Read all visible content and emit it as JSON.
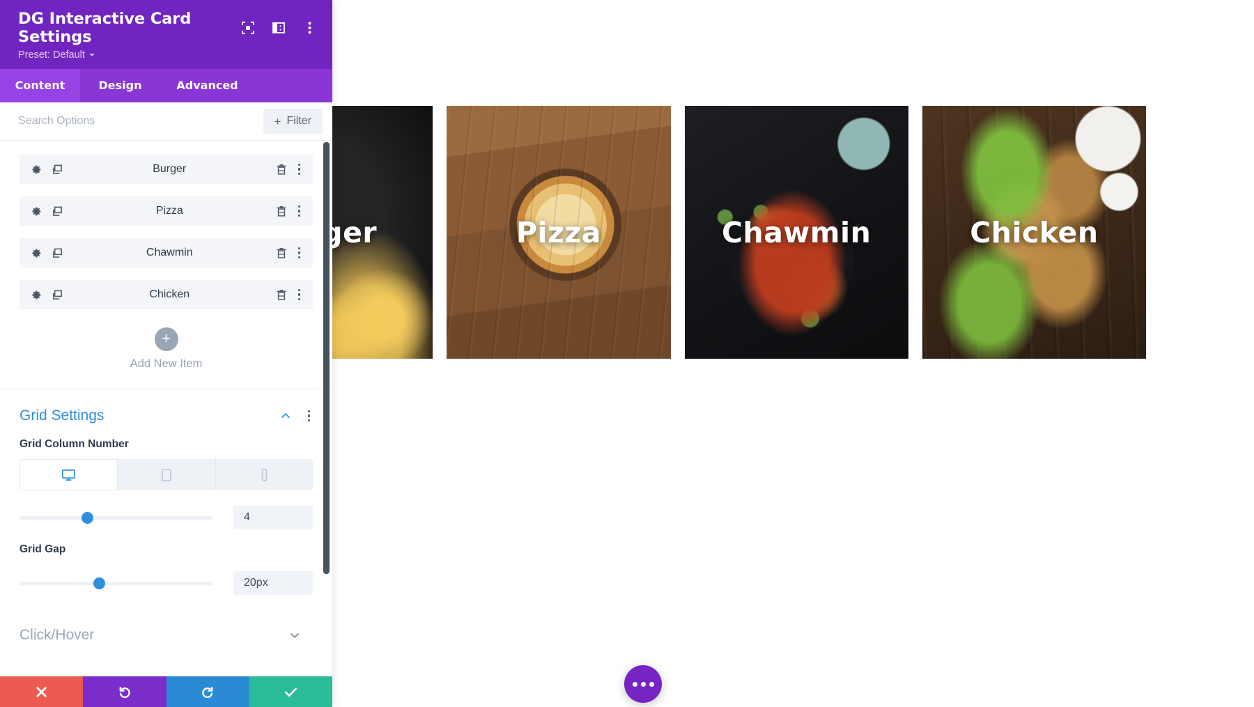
{
  "panel": {
    "title": "DG Interactive Card Settings",
    "preset_label": "Preset: Default",
    "header_icons": [
      {
        "name": "focus-target-icon"
      },
      {
        "name": "panel-layout-icon"
      },
      {
        "name": "more-vertical-icon"
      }
    ],
    "tabs": [
      {
        "label": "Content",
        "active": true
      },
      {
        "label": "Design",
        "active": false
      },
      {
        "label": "Advanced",
        "active": false
      }
    ],
    "search": {
      "placeholder": "Search Options",
      "value": ""
    },
    "filter_button": {
      "label": "Filter",
      "plus": "+"
    },
    "items": [
      {
        "label": "Burger"
      },
      {
        "label": "Pizza"
      },
      {
        "label": "Chawmin"
      },
      {
        "label": "Chicken"
      }
    ],
    "add_new_item": {
      "plus": "+",
      "label": "Add New Item"
    },
    "sections": [
      {
        "title": "Grid Settings",
        "expanded": true,
        "fields": [
          {
            "label": "Grid Column Number",
            "devices": [
              "desktop",
              "tablet",
              "phone"
            ],
            "active_device": "desktop",
            "value": "4",
            "slider_percent": 35
          },
          {
            "label": "Grid Gap",
            "value": "20px",
            "slider_percent": 41
          }
        ]
      },
      {
        "title": "Click/Hover",
        "expanded": false
      }
    ],
    "actions": [
      {
        "name": "cancel",
        "icon": "close-icon",
        "color": "#ed5a52"
      },
      {
        "name": "undo",
        "icon": "undo-icon",
        "color": "#7b2dcc"
      },
      {
        "name": "redo",
        "icon": "redo-icon",
        "color": "#2a8ad4"
      },
      {
        "name": "save",
        "icon": "check-icon",
        "color": "#2bbb99"
      }
    ],
    "colors": {
      "header_purple": "#7025c0",
      "tab_bar_purple": "#8a36d6",
      "tab_active_purple": "#9642e4",
      "section_blue": "#2e8fe0",
      "slider_blue": "#2e8fe0"
    }
  },
  "canvas": {
    "cards": [
      {
        "title": "Burger",
        "photo": "ph-burger"
      },
      {
        "title": "Pizza",
        "photo": "ph-pizza"
      },
      {
        "title": "Chawmin",
        "photo": "ph-chawmin"
      },
      {
        "title": "Chicken",
        "photo": "ph-chicken"
      }
    ],
    "fab": {
      "name": "more-options-fab",
      "color": "#7625c4"
    }
  }
}
